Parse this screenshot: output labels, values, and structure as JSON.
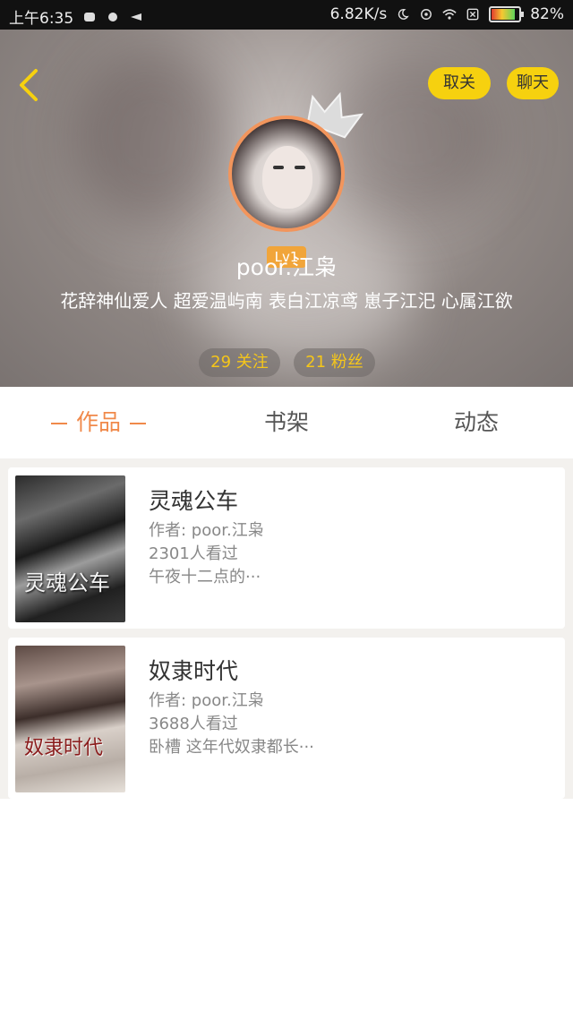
{
  "status_bar": {
    "time": "上午6:35",
    "speed": "6.82K/s",
    "battery_percent": "82%",
    "battery_level": 0.82
  },
  "header": {
    "unfollow_label": "取关",
    "chat_label": "聊天",
    "level": "Lv1",
    "username": "poor.江枭",
    "bio": "花辞神仙爱人 超爱温屿南 表白江凉鸢 崽子江汜 心属江欲",
    "following": "29 关注",
    "fans": "21 粉丝",
    "accent_color": "#f6d10f",
    "avatar_ring_color": "#f2955c"
  },
  "tabs": {
    "works": "作品",
    "shelf": "书架",
    "dynamics": "动态",
    "active_color": "#f0894a"
  },
  "books": [
    {
      "title": "灵魂公车",
      "author": "作者: poor.江枭",
      "views": "2301人看过",
      "desc": "午夜十二点的···",
      "cover_text": "灵魂公车"
    },
    {
      "title": "奴隶时代",
      "author": "作者: poor.江枭",
      "views": "3688人看过",
      "desc": "卧槽 这年代奴隶都长···",
      "cover_text": "奴隶时代"
    }
  ]
}
